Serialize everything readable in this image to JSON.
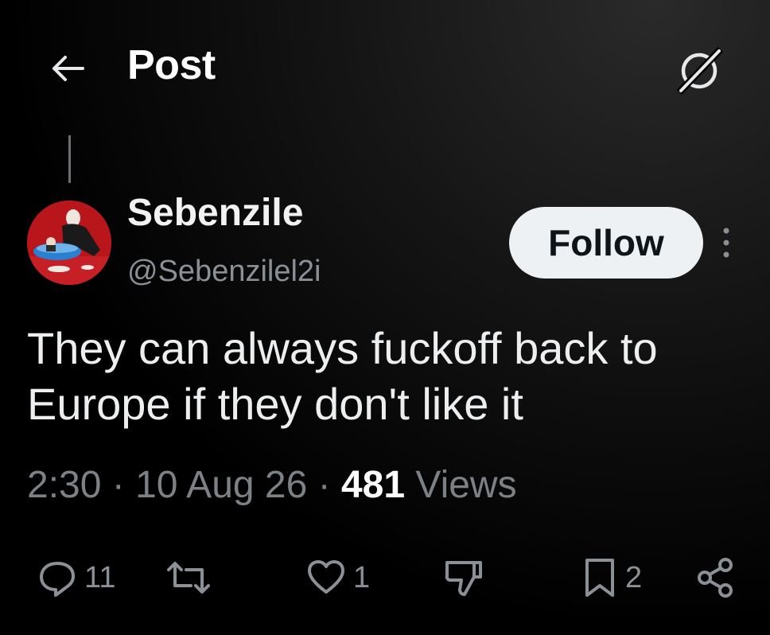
{
  "header": {
    "title": "Post",
    "back_icon": "arrow-left-icon",
    "grok_icon": "grok-icon"
  },
  "post": {
    "author_name": "Sebenzile",
    "author_handle": "@Sebenzilel2i",
    "follow_label": "Follow",
    "more_icon": "more-vertical-icon",
    "text": "They can always fuckoff back to Europe if they don't like it",
    "time": "2:30",
    "date": "10 Aug 26",
    "separator": "·",
    "views_count": "481",
    "views_label": "Views"
  },
  "actions": {
    "replies": "11",
    "reposts": "",
    "likes": "1",
    "bookmarks": "2"
  },
  "colors": {
    "background": "#000000",
    "follow_bg": "#eef1f3",
    "secondary_text": "#7c8186"
  }
}
